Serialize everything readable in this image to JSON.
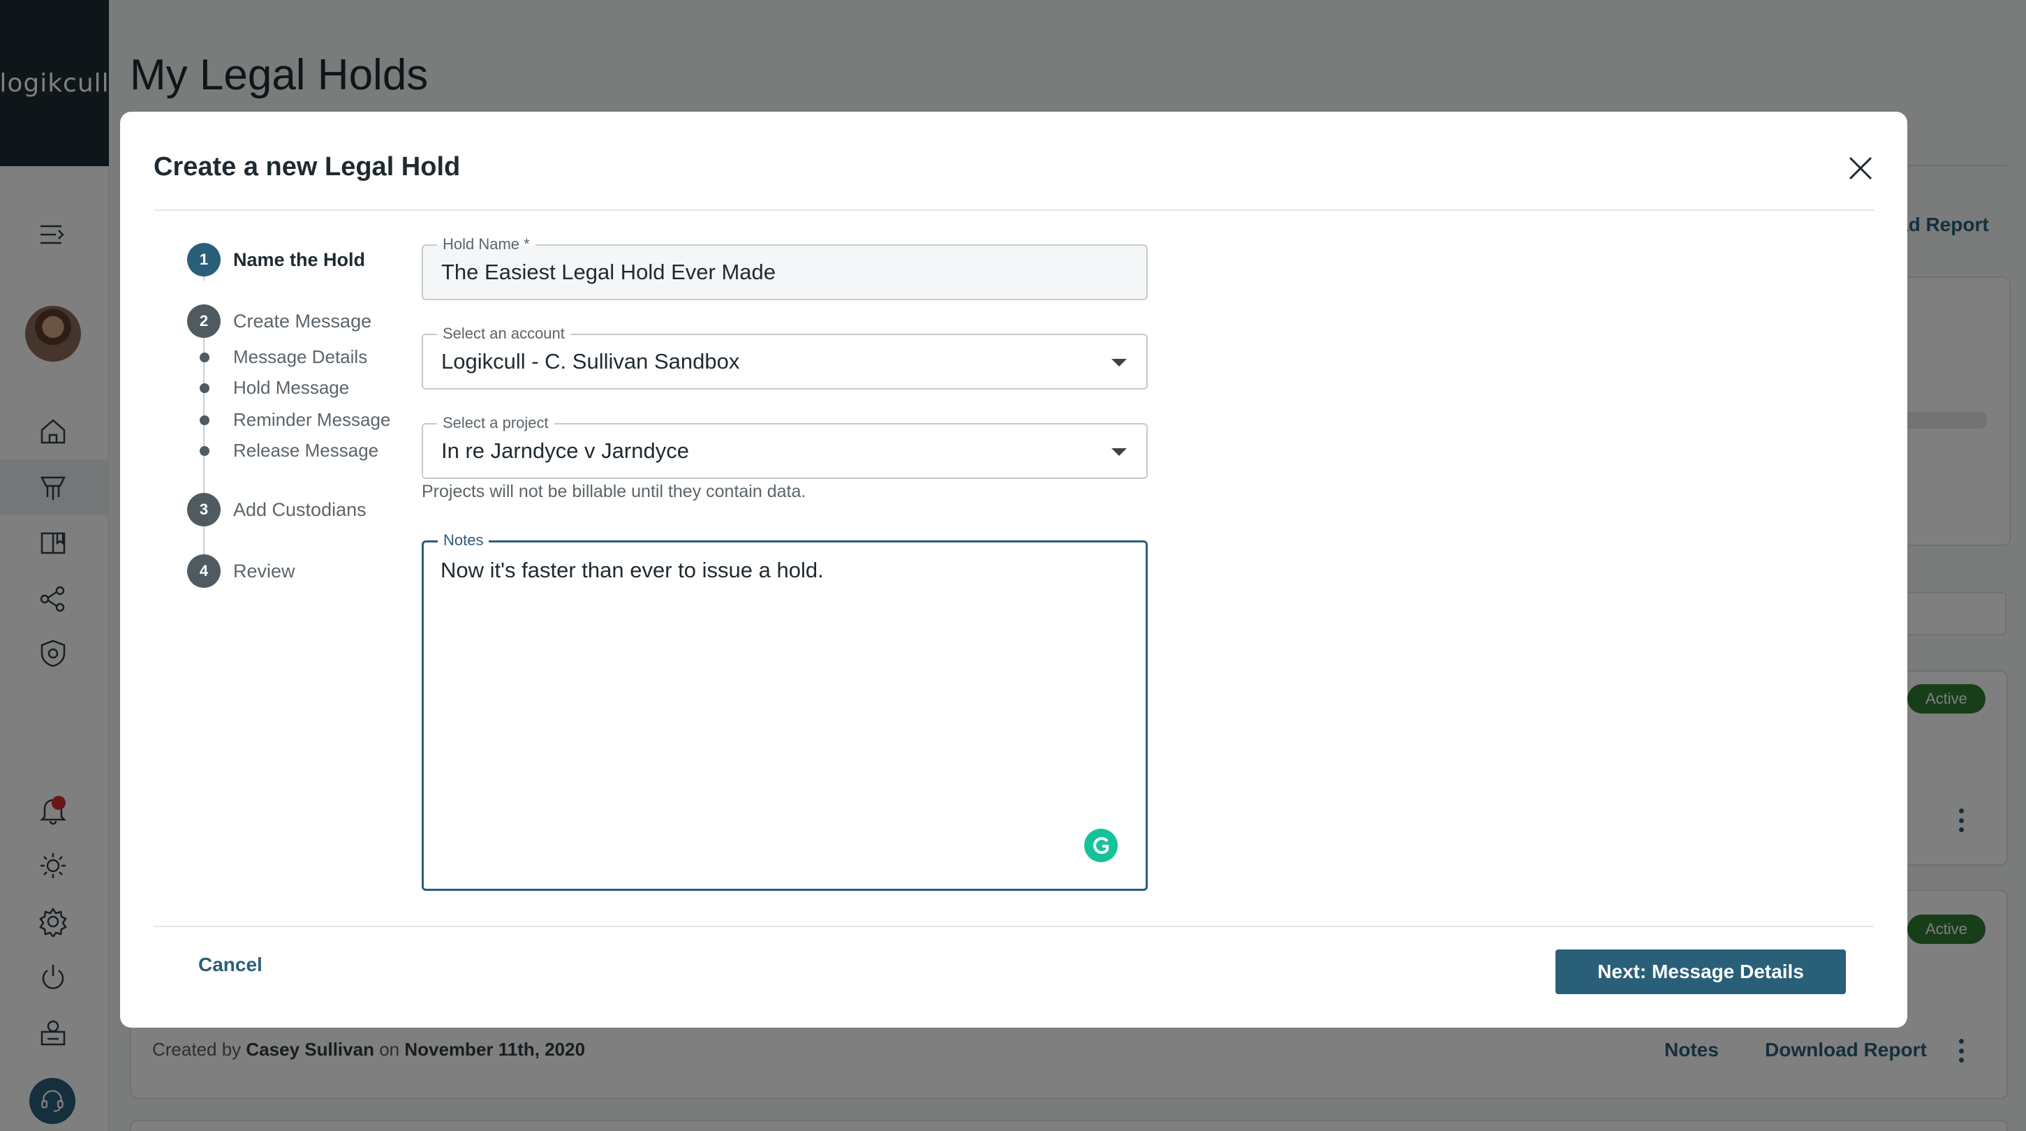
{
  "brand": {
    "logo_text": "logikcull"
  },
  "page": {
    "title": "My Legal Holds"
  },
  "background": {
    "download_report_partial": "ad Report",
    "status_1": "Active",
    "status_2": "Active",
    "row_partial_action": "t",
    "created_by_prefix": "Created by",
    "created_by_name": "Casey Sullivan",
    "created_on_prefix": "on",
    "created_date": "November 11th, 2020",
    "notes_link": "Notes",
    "download_report_link": "Download Report"
  },
  "sidebar": {
    "icons": [
      "menu-collapse-icon",
      "home-icon",
      "legal-hold-icon",
      "book-icon",
      "share-icon",
      "shield-icon",
      "bell-icon",
      "sun-icon",
      "settings-icon",
      "power-icon",
      "user-badge-icon",
      "support-icon"
    ]
  },
  "modal": {
    "title": "Create a new Legal Hold",
    "steps": [
      {
        "number": "1",
        "label": "Name the Hold"
      },
      {
        "number": "2",
        "label": "Create Message"
      },
      {
        "number": "3",
        "label": "Add Custodians"
      },
      {
        "number": "4",
        "label": "Review"
      }
    ],
    "substeps": [
      "Message Details",
      "Hold Message",
      "Reminder Message",
      "Release Message"
    ],
    "fields": {
      "hold_name": {
        "label": "Hold Name *",
        "value": "The Easiest Legal Hold Ever Made"
      },
      "account": {
        "label": "Select an account",
        "value": "Logikcull - C. Sullivan Sandbox"
      },
      "project": {
        "label": "Select a project",
        "value": "In re Jarndyce v Jarndyce",
        "helper": "Projects will not be billable until they contain data."
      },
      "notes": {
        "label": "Notes",
        "value": "Now it's faster than ever to issue a hold."
      }
    },
    "cancel_label": "Cancel",
    "next_label": "Next: Message Details"
  },
  "colors": {
    "primary": "#2a5f7a",
    "active_badge": "#2e7d32",
    "grammarly": "#15c39a",
    "notification": "#d32f2f"
  }
}
